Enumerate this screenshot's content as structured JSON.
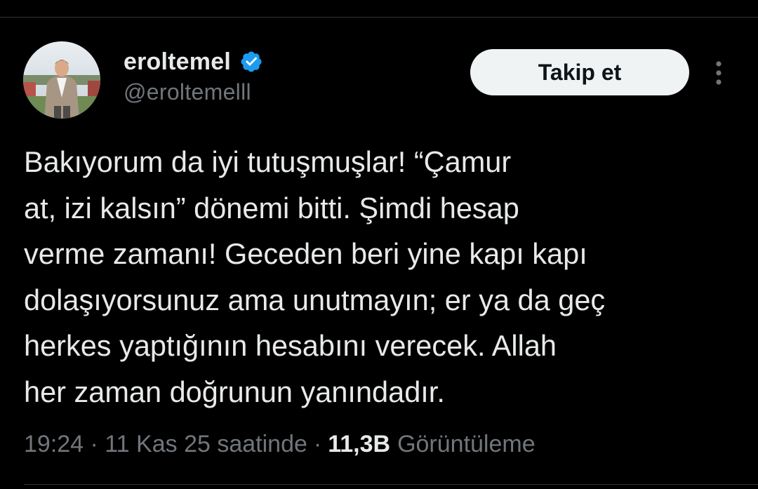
{
  "user": {
    "display_name": "eroltemel",
    "handle": "@eroltemelll",
    "verified": true,
    "avatar_icon": "profile-photo"
  },
  "follow_button": {
    "label": "Takip et"
  },
  "tweet": {
    "text": "Bakıyorum da iyi tutuşmuşlar! “Çamur\nat, izi kalsın” dönemi bitti. Şimdi hesap\nverme zamanı! Geceden beri yine kapı kapı\ndolaşıyorsunuz ama unutmayın; er ya da geç\nherkes yaptığının hesabını verecek. Allah\nher zaman doğrunun yanındadır."
  },
  "meta": {
    "time_ago": "19:24 · 11 Kas 25 saatinde",
    "separator": "·",
    "views_count": "11,3B",
    "views_label": "Görüntüleme"
  },
  "colors": {
    "background": "#000000",
    "primary_text": "#e7e9ea",
    "secondary_text": "#71767b",
    "verified_badge": "#1d9bf0",
    "button_bg": "#eff3f4"
  }
}
